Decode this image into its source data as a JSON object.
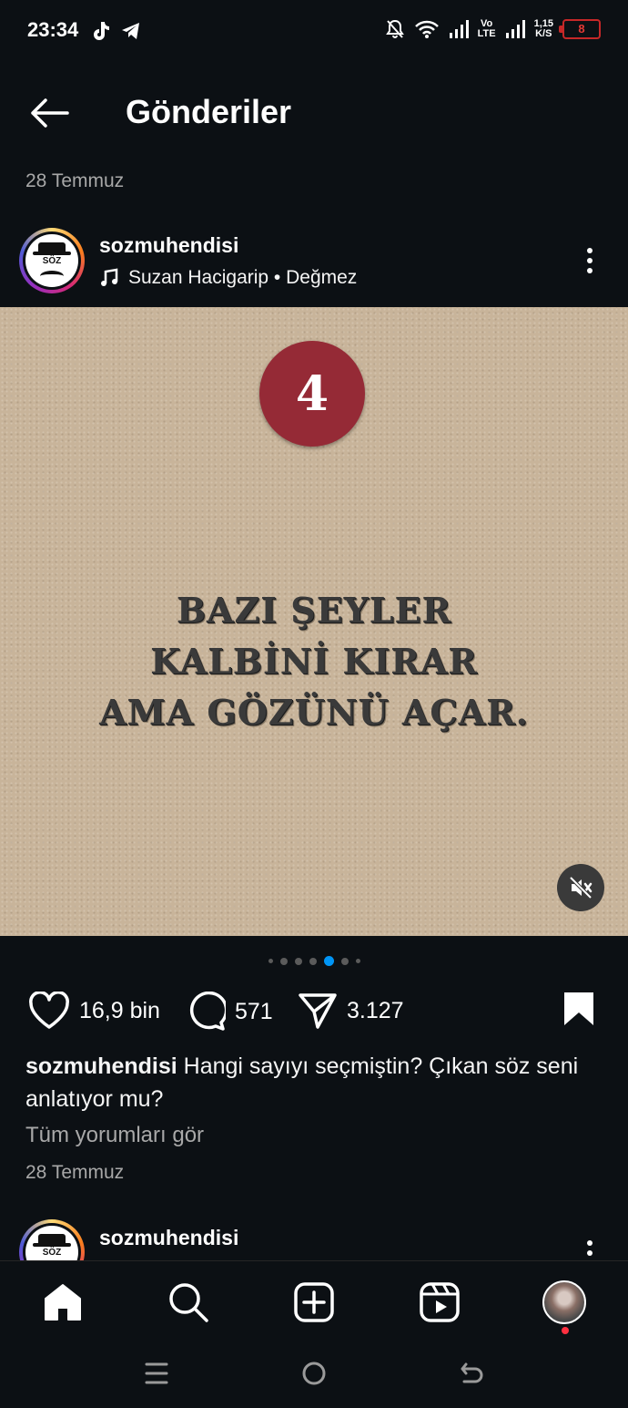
{
  "status_bar": {
    "time": "23:34",
    "network_lines": [
      "Vo",
      "LTE"
    ],
    "speed_lines": [
      "1,15",
      "K/S"
    ],
    "battery": "8"
  },
  "header": {
    "title": "Gönderiler",
    "date": "28 Temmuz"
  },
  "post": {
    "username": "sozmuhendisi",
    "avatar_text": "SÖZ",
    "audio": "Suzan Hacigarip • Değmez",
    "media": {
      "badge_number": "4",
      "quote_lines": [
        "BAZI ŞEYLER",
        "KALBİNİ KIRAR",
        "AMA GÖZÜNÜ AÇAR."
      ],
      "carousel_total": 7,
      "carousel_active": 5
    },
    "likes": "16,9 bin",
    "comments": "571",
    "shares": "3.127",
    "caption_username": "sozmuhendisi",
    "caption_text": "Hangi sayıyı seçmiştin? Çıkan söz seni anlatıyor mu?",
    "view_comments": "Tüm yorumları gör",
    "date": "28 Temmuz"
  },
  "next_post": {
    "username": "sozmuhendisi",
    "avatar_text": "SÖZ"
  },
  "colors": {
    "background": "#0c1014",
    "accent": "#0095f6",
    "badge": "#952a36",
    "notification": "#ff3040"
  },
  "bottom_nav": [
    "home-icon",
    "search-icon",
    "create-icon",
    "reels-icon",
    "profile-avatar"
  ]
}
